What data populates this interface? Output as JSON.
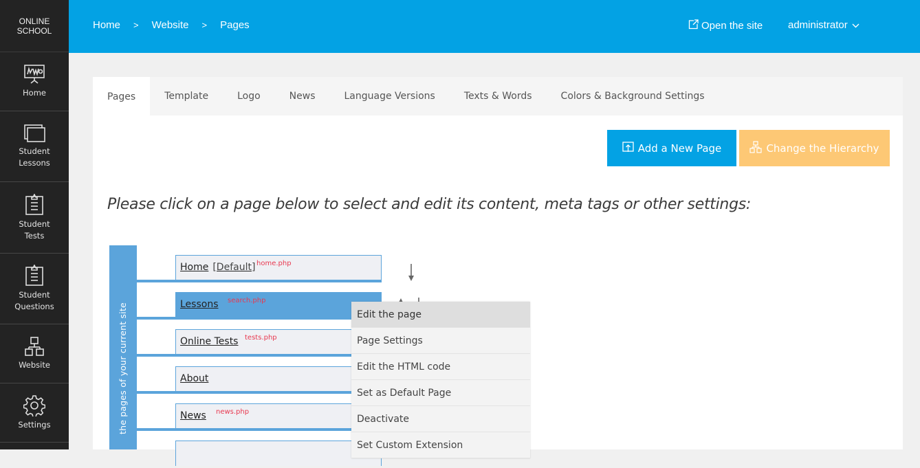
{
  "brand": {
    "line1": "ONLINE",
    "line2": "SCHOOL"
  },
  "sidebar": {
    "items": [
      {
        "id": "home",
        "label": "Home",
        "icon": "presentation-board-icon"
      },
      {
        "id": "lessons",
        "label": "Student Lessons",
        "icon": "stacked-windows-icon"
      },
      {
        "id": "tests",
        "label": "Student Tests",
        "icon": "clipboard-icon"
      },
      {
        "id": "questions",
        "label": "Student Questions",
        "icon": "clipboard-icon"
      },
      {
        "id": "website",
        "label": "Website",
        "icon": "sitemap-icon"
      },
      {
        "id": "settings",
        "label": "Settings",
        "icon": "gear-icon"
      }
    ]
  },
  "topbar": {
    "breadcrumb": [
      "Home",
      "Website",
      "Pages"
    ],
    "separator": ">",
    "open_site": "Open the site",
    "user": "administrator",
    "accent": "#03a2e4"
  },
  "tabs": [
    {
      "label": "Pages",
      "active": true
    },
    {
      "label": "Template"
    },
    {
      "label": "Logo"
    },
    {
      "label": "News"
    },
    {
      "label": "Language Versions"
    },
    {
      "label": "Texts & Words"
    },
    {
      "label": "Colors & Background Settings"
    }
  ],
  "actions": {
    "add_page": "Add a New Page",
    "change_hierarchy": "Change the Hierarchy"
  },
  "intro": "Please click on a page below to select and edit its content, meta tags or other settings:",
  "tree": {
    "label": "the pages of your current site",
    "pages": [
      {
        "name": "Home",
        "tag": "[Default]",
        "file": "home.php"
      },
      {
        "name": "Lessons",
        "tag": "",
        "file": "search.php",
        "selected": true
      },
      {
        "name": "Online Tests",
        "tag": "",
        "file": "tests.php"
      },
      {
        "name": "About",
        "tag": "",
        "file": ""
      },
      {
        "name": "News",
        "tag": "",
        "file": "news.php"
      }
    ]
  },
  "context_menu": {
    "items": [
      {
        "label": "Edit the page",
        "hover": true
      },
      {
        "label": "Page Settings"
      },
      {
        "label": "Edit the HTML code"
      },
      {
        "label": "Set as Default Page"
      },
      {
        "label": "Deactivate"
      },
      {
        "label": "Set Custom Extension"
      }
    ]
  }
}
